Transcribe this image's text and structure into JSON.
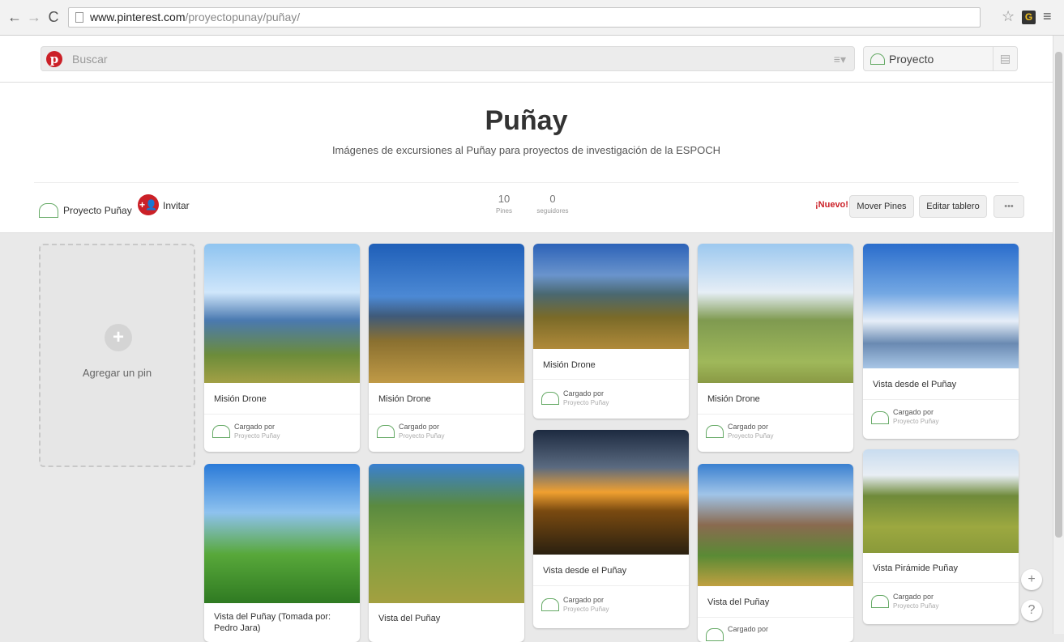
{
  "browser": {
    "url_host": "www.pinterest.com",
    "url_path": "/proyectopunay/puñay/"
  },
  "header": {
    "search_placeholder": "Buscar",
    "user_label": "Proyecto"
  },
  "board": {
    "title": "Puñay",
    "description": "Imágenes de excursiones al Puñay para proyectos de investigación de la ESPOCH",
    "owner": "Proyecto Puñay",
    "invite": "Invitar",
    "stats": [
      {
        "num": "10",
        "label": "Pines"
      },
      {
        "num": "0",
        "label": "seguidores"
      }
    ],
    "nuevo": "¡Nuevo!",
    "move_pins": "Mover Pines",
    "edit_board": "Editar tablero",
    "more": "•••"
  },
  "add_pin": {
    "label": "Agregar un pin"
  },
  "pins": [
    {
      "desc": "Misión Drone",
      "src1": "Cargado por",
      "src2": "Proyecto Puñay"
    },
    {
      "desc": "Misión Drone",
      "src1": "Cargado por",
      "src2": "Proyecto Puñay"
    },
    {
      "desc": "Misión Drone",
      "src1": "Cargado por",
      "src2": "Proyecto Puñay"
    },
    {
      "desc": "Misión Drone",
      "src1": "Cargado por",
      "src2": "Proyecto Puñay"
    },
    {
      "desc": "Vista desde el Puñay",
      "src1": "Cargado por",
      "src2": "Proyecto Puñay"
    },
    {
      "desc": "Vista del Puñay (Tomada por: Pedro Jara)"
    },
    {
      "desc": "Vista del Puñay"
    },
    {
      "desc": "Vista desde el Puñay",
      "src1": "Cargado por",
      "src2": "Proyecto Puñay"
    },
    {
      "desc": "Vista del Puñay",
      "src1": "Cargado por"
    },
    {
      "desc": "Vista Pirámide Puñay",
      "src1": "Cargado por",
      "src2": "Proyecto Puñay"
    }
  ],
  "floating": {
    "add": "+",
    "help": "?"
  }
}
